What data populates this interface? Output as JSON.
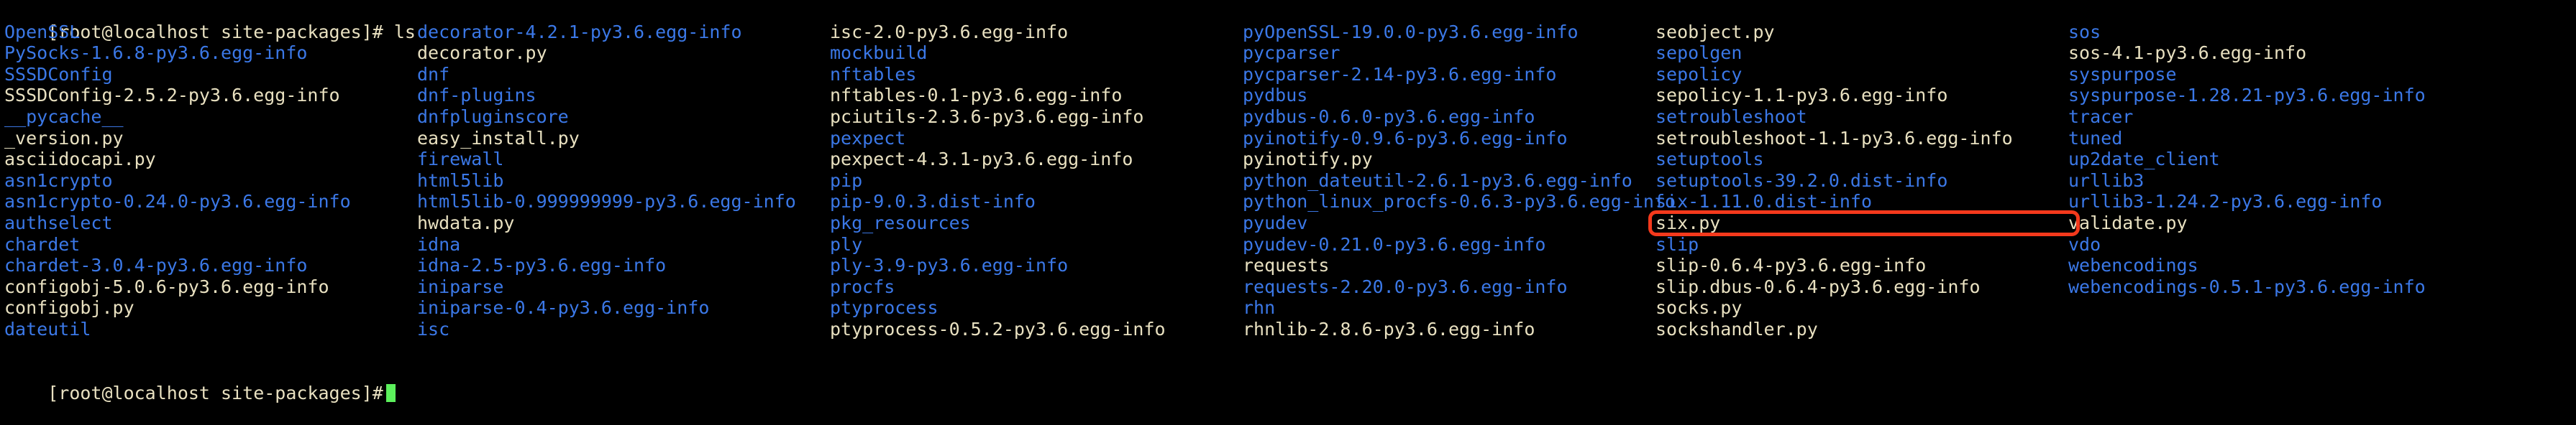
{
  "terminal": {
    "prompt_top": "[root@localhost site-packages]# ls",
    "prompt_bottom": "[root@localhost site-packages]#",
    "command": "ls",
    "host": "localhost",
    "user": "root",
    "cwd": "site-packages",
    "cursor": "block-cursor",
    "colors": {
      "background": "#000000",
      "directory": "#3b78e7",
      "file": "#e8e0c0",
      "cursor": "#5cf05c",
      "highlight": "#f4391c"
    }
  },
  "highlight": {
    "target": "six.py",
    "column": 5,
    "row": 12,
    "shape": "rounded-rectangle"
  },
  "listing": {
    "columns": [
      [
        {
          "name": "OpenSSL",
          "type": "dir"
        },
        {
          "name": "PySocks-1.6.8-py3.6.egg-info",
          "type": "dir"
        },
        {
          "name": "SSSDConfig",
          "type": "dir"
        },
        {
          "name": "SSSDConfig-2.5.2-py3.6.egg-info",
          "type": "file"
        },
        {
          "name": "__pycache__",
          "type": "dir"
        },
        {
          "name": "_version.py",
          "type": "file"
        },
        {
          "name": "asciidocapi.py",
          "type": "file"
        },
        {
          "name": "asn1crypto",
          "type": "dir"
        },
        {
          "name": "asn1crypto-0.24.0-py3.6.egg-info",
          "type": "dir"
        },
        {
          "name": "authselect",
          "type": "dir"
        },
        {
          "name": "chardet",
          "type": "dir"
        },
        {
          "name": "chardet-3.0.4-py3.6.egg-info",
          "type": "dir"
        },
        {
          "name": "configobj-5.0.6-py3.6.egg-info",
          "type": "file"
        },
        {
          "name": "configobj.py",
          "type": "file"
        },
        {
          "name": "dateutil",
          "type": "dir"
        },
        {
          "name": "",
          "type": "empty"
        }
      ],
      [
        {
          "name": "decorator-4.2.1-py3.6.egg-info",
          "type": "dir"
        },
        {
          "name": "decorator.py",
          "type": "file"
        },
        {
          "name": "dnf",
          "type": "dir"
        },
        {
          "name": "dnf-plugins",
          "type": "dir"
        },
        {
          "name": "dnfpluginscore",
          "type": "dir"
        },
        {
          "name": "easy_install.py",
          "type": "file"
        },
        {
          "name": "firewall",
          "type": "dir"
        },
        {
          "name": "html5lib",
          "type": "dir"
        },
        {
          "name": "html5lib-0.999999999-py3.6.egg-info",
          "type": "dir"
        },
        {
          "name": "hwdata.py",
          "type": "file"
        },
        {
          "name": "idna",
          "type": "dir"
        },
        {
          "name": "idna-2.5-py3.6.egg-info",
          "type": "dir"
        },
        {
          "name": "iniparse",
          "type": "dir"
        },
        {
          "name": "iniparse-0.4-py3.6.egg-info",
          "type": "dir"
        },
        {
          "name": "isc",
          "type": "dir"
        },
        {
          "name": "",
          "type": "empty"
        }
      ],
      [
        {
          "name": "isc-2.0-py3.6.egg-info",
          "type": "file"
        },
        {
          "name": "mockbuild",
          "type": "dir"
        },
        {
          "name": "nftables",
          "type": "dir"
        },
        {
          "name": "nftables-0.1-py3.6.egg-info",
          "type": "file"
        },
        {
          "name": "pciutils-2.3.6-py3.6.egg-info",
          "type": "file"
        },
        {
          "name": "pexpect",
          "type": "dir"
        },
        {
          "name": "pexpect-4.3.1-py3.6.egg-info",
          "type": "file"
        },
        {
          "name": "pip",
          "type": "dir"
        },
        {
          "name": "pip-9.0.3.dist-info",
          "type": "dir"
        },
        {
          "name": "pkg_resources",
          "type": "dir"
        },
        {
          "name": "ply",
          "type": "dir"
        },
        {
          "name": "ply-3.9-py3.6.egg-info",
          "type": "dir"
        },
        {
          "name": "procfs",
          "type": "dir"
        },
        {
          "name": "ptyprocess",
          "type": "dir"
        },
        {
          "name": "ptyprocess-0.5.2-py3.6.egg-info",
          "type": "file"
        },
        {
          "name": "",
          "type": "empty"
        }
      ],
      [
        {
          "name": "pyOpenSSL-19.0.0-py3.6.egg-info",
          "type": "dir"
        },
        {
          "name": "pycparser",
          "type": "dir"
        },
        {
          "name": "pycparser-2.14-py3.6.egg-info",
          "type": "dir"
        },
        {
          "name": "pydbus",
          "type": "dir"
        },
        {
          "name": "pydbus-0.6.0-py3.6.egg-info",
          "type": "dir"
        },
        {
          "name": "pyinotify-0.9.6-py3.6.egg-info",
          "type": "dir"
        },
        {
          "name": "pyinotify.py",
          "type": "file"
        },
        {
          "name": "python_dateutil-2.6.1-py3.6.egg-info",
          "type": "dir"
        },
        {
          "name": "python_linux_procfs-0.6.3-py3.6.egg-info",
          "type": "dir"
        },
        {
          "name": "pyudev",
          "type": "dir"
        },
        {
          "name": "pyudev-0.21.0-py3.6.egg-info",
          "type": "dir"
        },
        {
          "name": "requests",
          "type": "file"
        },
        {
          "name": "requests-2.20.0-py3.6.egg-info",
          "type": "dir"
        },
        {
          "name": "rhn",
          "type": "dir"
        },
        {
          "name": "rhnlib-2.8.6-py3.6.egg-info",
          "type": "file"
        },
        {
          "name": "",
          "type": "empty"
        }
      ],
      [
        {
          "name": "seobject.py",
          "type": "file"
        },
        {
          "name": "sepolgen",
          "type": "dir"
        },
        {
          "name": "sepolicy",
          "type": "dir"
        },
        {
          "name": "sepolicy-1.1-py3.6.egg-info",
          "type": "file"
        },
        {
          "name": "setroubleshoot",
          "type": "dir"
        },
        {
          "name": "setroubleshoot-1.1-py3.6.egg-info",
          "type": "file"
        },
        {
          "name": "setuptools",
          "type": "dir"
        },
        {
          "name": "setuptools-39.2.0.dist-info",
          "type": "dir"
        },
        {
          "name": "six-1.11.0.dist-info",
          "type": "dir"
        },
        {
          "name": "six.py",
          "type": "file"
        },
        {
          "name": "slip",
          "type": "dir"
        },
        {
          "name": "slip-0.6.4-py3.6.egg-info",
          "type": "file"
        },
        {
          "name": "slip.dbus-0.6.4-py3.6.egg-info",
          "type": "file"
        },
        {
          "name": "socks.py",
          "type": "file"
        },
        {
          "name": "sockshandler.py",
          "type": "file"
        },
        {
          "name": "",
          "type": "empty"
        }
      ],
      [
        {
          "name": "sos",
          "type": "dir"
        },
        {
          "name": "sos-4.1-py3.6.egg-info",
          "type": "file"
        },
        {
          "name": "syspurpose",
          "type": "dir"
        },
        {
          "name": "syspurpose-1.28.21-py3.6.egg-info",
          "type": "dir"
        },
        {
          "name": "tracer",
          "type": "dir"
        },
        {
          "name": "tuned",
          "type": "dir"
        },
        {
          "name": "up2date_client",
          "type": "dir"
        },
        {
          "name": "urllib3",
          "type": "dir"
        },
        {
          "name": "urllib3-1.24.2-py3.6.egg-info",
          "type": "dir"
        },
        {
          "name": "validate.py",
          "type": "file"
        },
        {
          "name": "vdo",
          "type": "dir"
        },
        {
          "name": "webencodings",
          "type": "dir"
        },
        {
          "name": "webencodings-0.5.1-py3.6.egg-info",
          "type": "dir"
        },
        {
          "name": "",
          "type": "empty"
        },
        {
          "name": "",
          "type": "empty"
        },
        {
          "name": "",
          "type": "empty"
        }
      ]
    ]
  }
}
